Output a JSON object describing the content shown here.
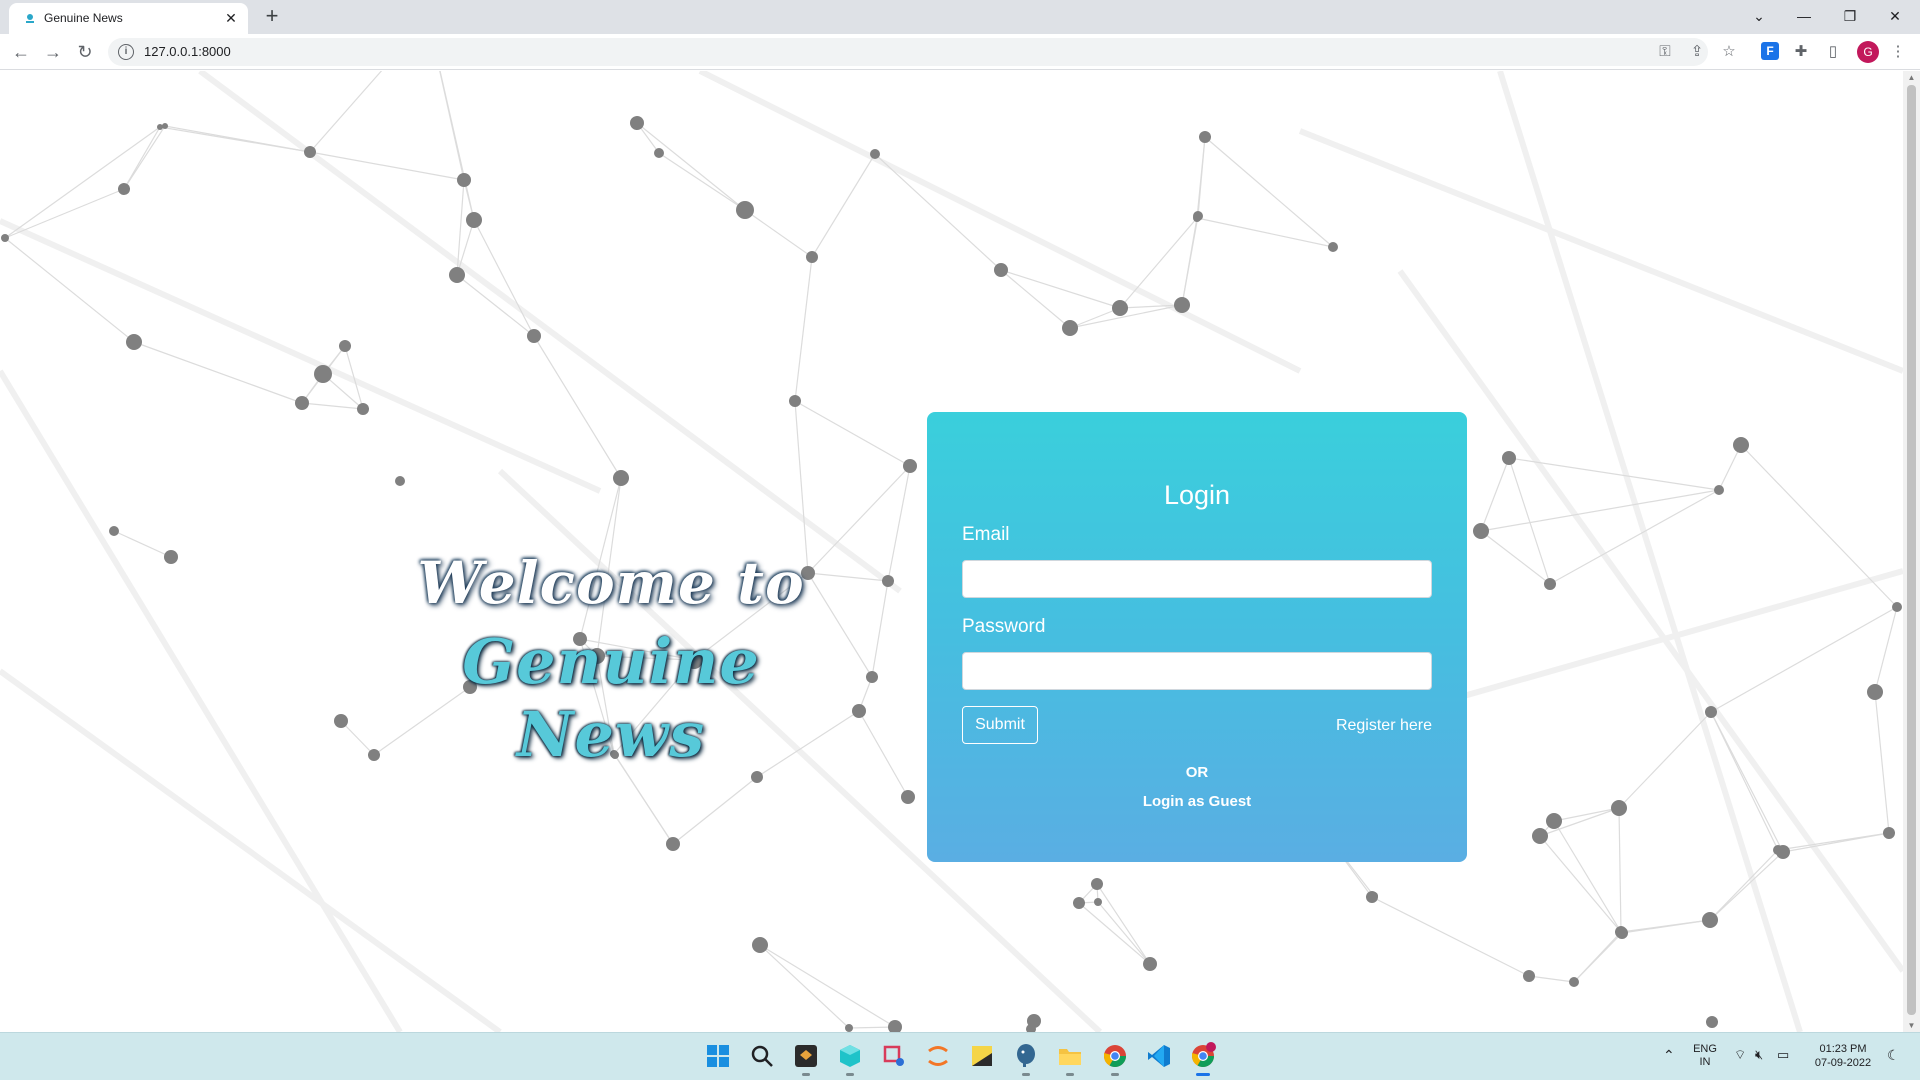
{
  "browser": {
    "tab_title": "Genuine News",
    "url": "127.0.0.1:8000",
    "profile_initial": "G",
    "ext_label": "F"
  },
  "page": {
    "welcome_line1": "Welcome to",
    "welcome_line2": "Genuine News"
  },
  "login": {
    "title": "Login",
    "email_label": "Email",
    "email_value": "",
    "password_label": "Password",
    "password_value": "",
    "submit_label": "Submit",
    "register_label": "Register here",
    "or_label": "OR",
    "guest_label": "Login as Guest"
  },
  "taskbar": {
    "lang_line1": "ENG",
    "lang_line2": "IN",
    "time": "01:23 PM",
    "date": "07-09-2022",
    "apps": [
      "start-icon",
      "search-icon",
      "app-box-icon",
      "cube-icon",
      "snipping-icon",
      "jupyter-icon",
      "sticky-notes-icon",
      "postgres-icon",
      "file-explorer-icon",
      "chrome-icon",
      "vscode-icon",
      "chrome-profile-icon"
    ]
  },
  "colors": {
    "card_top": "#3acfdc",
    "card_bottom": "#5aaee3",
    "node": "#808080",
    "taskbar": "#cfe8ec"
  }
}
